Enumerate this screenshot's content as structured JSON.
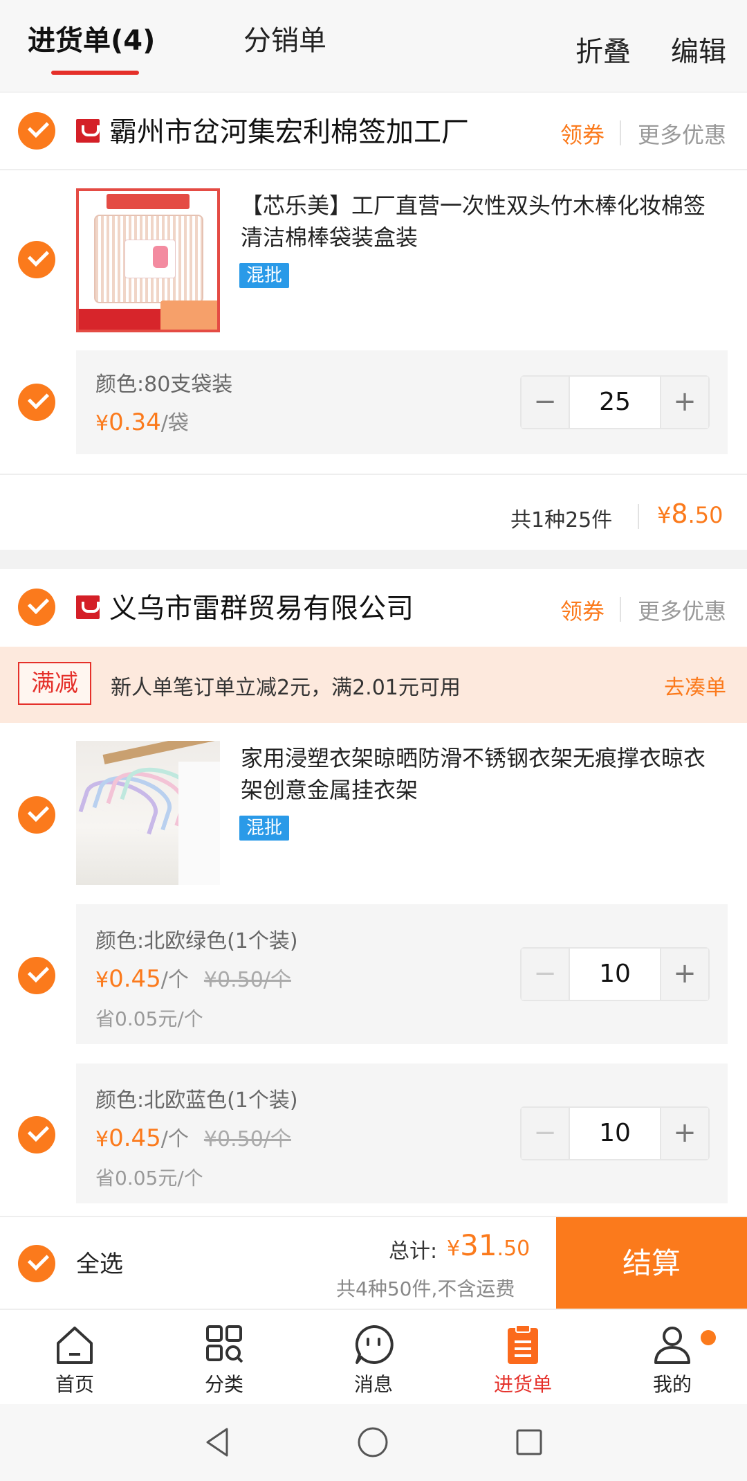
{
  "header": {
    "tab_active": "进货单(4)",
    "tab_other": "分销单",
    "fold": "折叠",
    "edit": "编辑"
  },
  "shops": [
    {
      "name": "霸州市岔河集宏利棉签加工厂",
      "coupon": "领券",
      "more": "更多优惠",
      "product": {
        "title_line1": "【芯乐美】工厂直营一次性双头竹木棒化妆棉签",
        "title_line2": "清洁棉棒袋装盒装",
        "badge": "混批",
        "specs": [
          {
            "name": "颜色:80支袋装",
            "price_symbol": "¥",
            "price": "0.34",
            "unit": "/袋",
            "qty": "25"
          }
        ]
      },
      "summary_count": "共1种25件",
      "summary_symbol": "¥",
      "summary_int": "8",
      "summary_dec": ".50"
    },
    {
      "name": "义乌市雷群贸易有限公司",
      "coupon": "领券",
      "more": "更多优惠",
      "promo": {
        "tag": "满减",
        "text": "新人单笔订单立减2元，满2.01元可用",
        "link": "去凑单"
      },
      "product": {
        "title_line1": "家用浸塑衣架晾晒防滑不锈钢衣架无痕撑衣晾衣",
        "title_line2": "架创意金属挂衣架",
        "badge": "混批",
        "specs": [
          {
            "name": "颜色:北欧绿色(1个装)",
            "price_symbol": "¥",
            "price": "0.45",
            "unit": "/个",
            "old_price": "¥0.50/个",
            "save": "省0.05元/个",
            "qty": "10"
          },
          {
            "name": "颜色:北欧蓝色(1个装)",
            "price_symbol": "¥",
            "price": "0.45",
            "unit": "/个",
            "old_price": "¥0.50/个",
            "save": "省0.05元/个",
            "qty": "10"
          }
        ]
      }
    }
  ],
  "stepper": {
    "minus": "−",
    "plus": "+"
  },
  "checkout_bar": {
    "select_all": "全选",
    "total_label": "总计:",
    "total_symbol": "¥",
    "total_int": "31",
    "total_dec": ".50",
    "note": "共4种50件,不含运费",
    "button": "结算"
  },
  "tabbar": [
    {
      "label": "首页",
      "icon": "home-icon"
    },
    {
      "label": "分类",
      "icon": "category-icon"
    },
    {
      "label": "消息",
      "icon": "message-icon"
    },
    {
      "label": "进货单",
      "icon": "purchase-list-icon",
      "active": true
    },
    {
      "label": "我的",
      "icon": "profile-icon"
    }
  ],
  "colors": {
    "accent": "#fb7a1c",
    "red": "#e5302a",
    "badge_blue": "#2a9ae8"
  }
}
